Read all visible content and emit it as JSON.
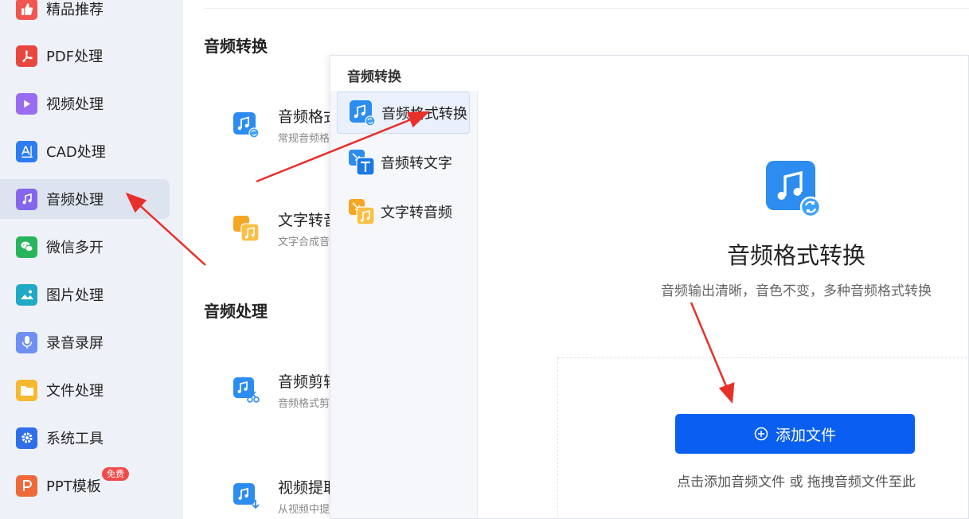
{
  "sidebar": {
    "items": [
      {
        "label": "精品推荐",
        "icon": "thumbs-up-icon",
        "color": "#f0554f"
      },
      {
        "label": "PDF处理",
        "icon": "pdf-icon",
        "color": "#e8473f"
      },
      {
        "label": "视频处理",
        "icon": "play-icon",
        "color": "#9a6cf0"
      },
      {
        "label": "CAD处理",
        "icon": "cad-icon",
        "color": "#2d7cf0"
      },
      {
        "label": "音频处理",
        "icon": "music-note-icon",
        "color": "#8466ec"
      },
      {
        "label": "微信多开",
        "icon": "wechat-icon",
        "color": "#26b55a"
      },
      {
        "label": "图片处理",
        "icon": "image-icon",
        "color": "#21a8c5"
      },
      {
        "label": "录音录屏",
        "icon": "microphone-icon",
        "color": "#6f8ff2"
      },
      {
        "label": "文件处理",
        "icon": "folder-icon",
        "color": "#f5b82e"
      },
      {
        "label": "系统工具",
        "icon": "gear-icon",
        "color": "#2f6ee8"
      },
      {
        "label": "PPT模板",
        "icon": "ppt-icon",
        "color": "#ee6a3b",
        "badge": "免费"
      }
    ],
    "active_index": 4
  },
  "background": {
    "section1_title": "音频转换",
    "section2_title": "音频处理",
    "cards": [
      {
        "title": "音频格式",
        "subtitle": "常规音频格",
        "icon": "audio-convert-icon"
      },
      {
        "title": "文字转音",
        "subtitle": "文字合成音",
        "icon": "text-to-audio-icon"
      },
      {
        "title": "音频剪辑",
        "subtitle": "音频格式剪",
        "icon": "audio-cut-icon"
      },
      {
        "title": "视频提取",
        "subtitle": "从视频中提",
        "icon": "video-extract-icon"
      }
    ]
  },
  "panel": {
    "title": "音频转换",
    "nav": [
      {
        "label": "音频格式转换",
        "icon": "audio-convert-icon"
      },
      {
        "label": "音频转文字",
        "icon": "audio-to-text-icon"
      },
      {
        "label": "文字转音频",
        "icon": "text-to-audio-icon"
      }
    ],
    "active_nav": 0,
    "main_title": "音频格式转换",
    "main_subtitle": "音频输出清晰，音色不变，多种音频格式转换",
    "add_button": "添加文件",
    "drop_hint": "点击添加音频文件 或 拖拽音频文件至此"
  },
  "colors": {
    "accent": "#0a5ff0",
    "annotation_arrow": "#e8302a",
    "sidebar_bg": "#eef2f8"
  }
}
